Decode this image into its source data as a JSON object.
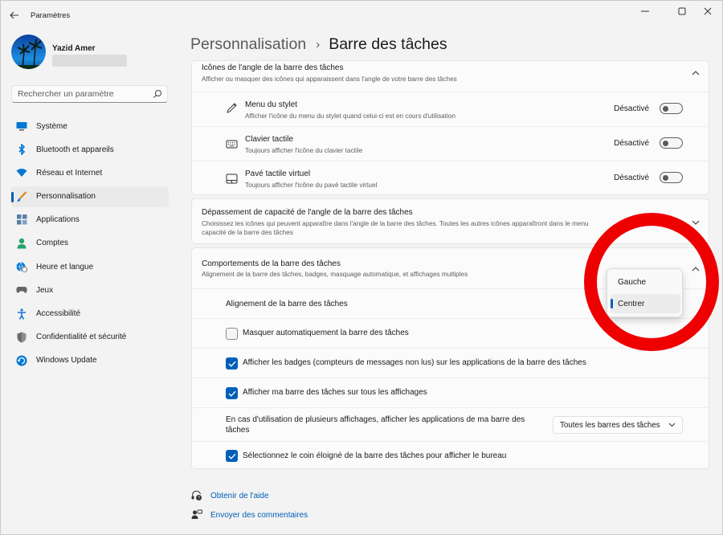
{
  "window": {
    "title": "Paramètres",
    "back_icon": "back-arrow-icon",
    "controls": [
      "minimize-icon",
      "maximize-icon",
      "close-icon"
    ]
  },
  "user": {
    "name": "Yazid Amer"
  },
  "search": {
    "placeholder": "Rechercher un paramètre"
  },
  "nav": {
    "items": [
      {
        "label": "Système",
        "icon": "display-icon",
        "color": "#0078d4"
      },
      {
        "label": "Bluetooth et appareils",
        "icon": "bluetooth-icon",
        "color": "#0078d4"
      },
      {
        "label": "Réseau et Internet",
        "icon": "wifi-icon",
        "color": "#0078d4"
      },
      {
        "label": "Personnalisation",
        "icon": "brush-icon",
        "color": "#e8811a"
      },
      {
        "label": "Applications",
        "icon": "apps-icon",
        "color": "#5c7fa8"
      },
      {
        "label": "Comptes",
        "icon": "person-icon",
        "color": "#24a56b"
      },
      {
        "label": "Heure et langue",
        "icon": "globe-clock-icon",
        "color": "#0078d4"
      },
      {
        "label": "Jeux",
        "icon": "gamepad-icon",
        "color": "#666666"
      },
      {
        "label": "Accessibilité",
        "icon": "accessibility-icon",
        "color": "#1a73d9"
      },
      {
        "label": "Confidentialité et sécurité",
        "icon": "shield-icon",
        "color": "#6b6b6b"
      },
      {
        "label": "Windows Update",
        "icon": "update-icon",
        "color": "#0078d4"
      }
    ],
    "active_index": 3
  },
  "header": {
    "parent": "Personnalisation",
    "separator": "›",
    "current": "Barre des tâches"
  },
  "corner_icons": {
    "title": "Icônes de l'angle de la barre des tâches",
    "description": "Afficher ou masquer des icônes qui apparaissent dans l'angle de votre barre des tâches",
    "expanded": true,
    "items": [
      {
        "title": "Menu du stylet",
        "description": "Afficher l'icône du menu du stylet quand celui-ci est en cours d'utilisation",
        "state": "Désactivé",
        "icon": "pen-icon",
        "on": false
      },
      {
        "title": "Clavier tactile",
        "description": "Toujours afficher l'icône du clavier tactile",
        "state": "Désactivé",
        "icon": "keyboard-icon",
        "on": false
      },
      {
        "title": "Pavé tactile virtuel",
        "description": "Toujours afficher l'icône du pavé tactile virtuel",
        "state": "Désactivé",
        "icon": "touchpad-icon",
        "on": false
      }
    ]
  },
  "overflow": {
    "title": "Dépassement de capacité de l'angle de la barre des tâches",
    "description_line1": "Choisissez les icônes qui peuvent apparaître dans l'angle de la barre des tâches. Toutes les autres icônes apparaîtront dans le menu",
    "description_line2": "capacité de la barre des tâches",
    "expanded": false
  },
  "behaviors": {
    "title": "Comportements de la barre des tâches",
    "description": "Alignement de la barre des tâches, badges, masquage automatique, et affichages multiples",
    "expanded": true,
    "alignment_label": "Alignement de la barre des tâches",
    "checkboxes": [
      {
        "label": "Masquer automatiquement la barre des tâches",
        "checked": false
      },
      {
        "label": "Afficher les badges (compteurs de messages non lus) sur les applications de la barre des tâches",
        "checked": true
      },
      {
        "label": "Afficher ma barre des tâches sur tous les affichages",
        "checked": true
      }
    ],
    "multi_display_label_line1": "En cas d'utilisation de plusieurs affichages, afficher les applications de ma barre des",
    "multi_display_label_line2": "tâches",
    "multi_display_value": "Toutes les barres des tâches",
    "far_corner": {
      "label": "Sélectionnez le coin éloigné de la barre des tâches pour afficher le bureau",
      "checked": true
    }
  },
  "alignment_menu": {
    "options": [
      "Gauche",
      "Centrer"
    ],
    "selected": "Centrer"
  },
  "footer": {
    "help": "Obtenir de l'aide",
    "feedback": "Envoyer des commentaires"
  },
  "colors": {
    "accent": "#005fb8",
    "annotation_ring": "#ee0000"
  }
}
